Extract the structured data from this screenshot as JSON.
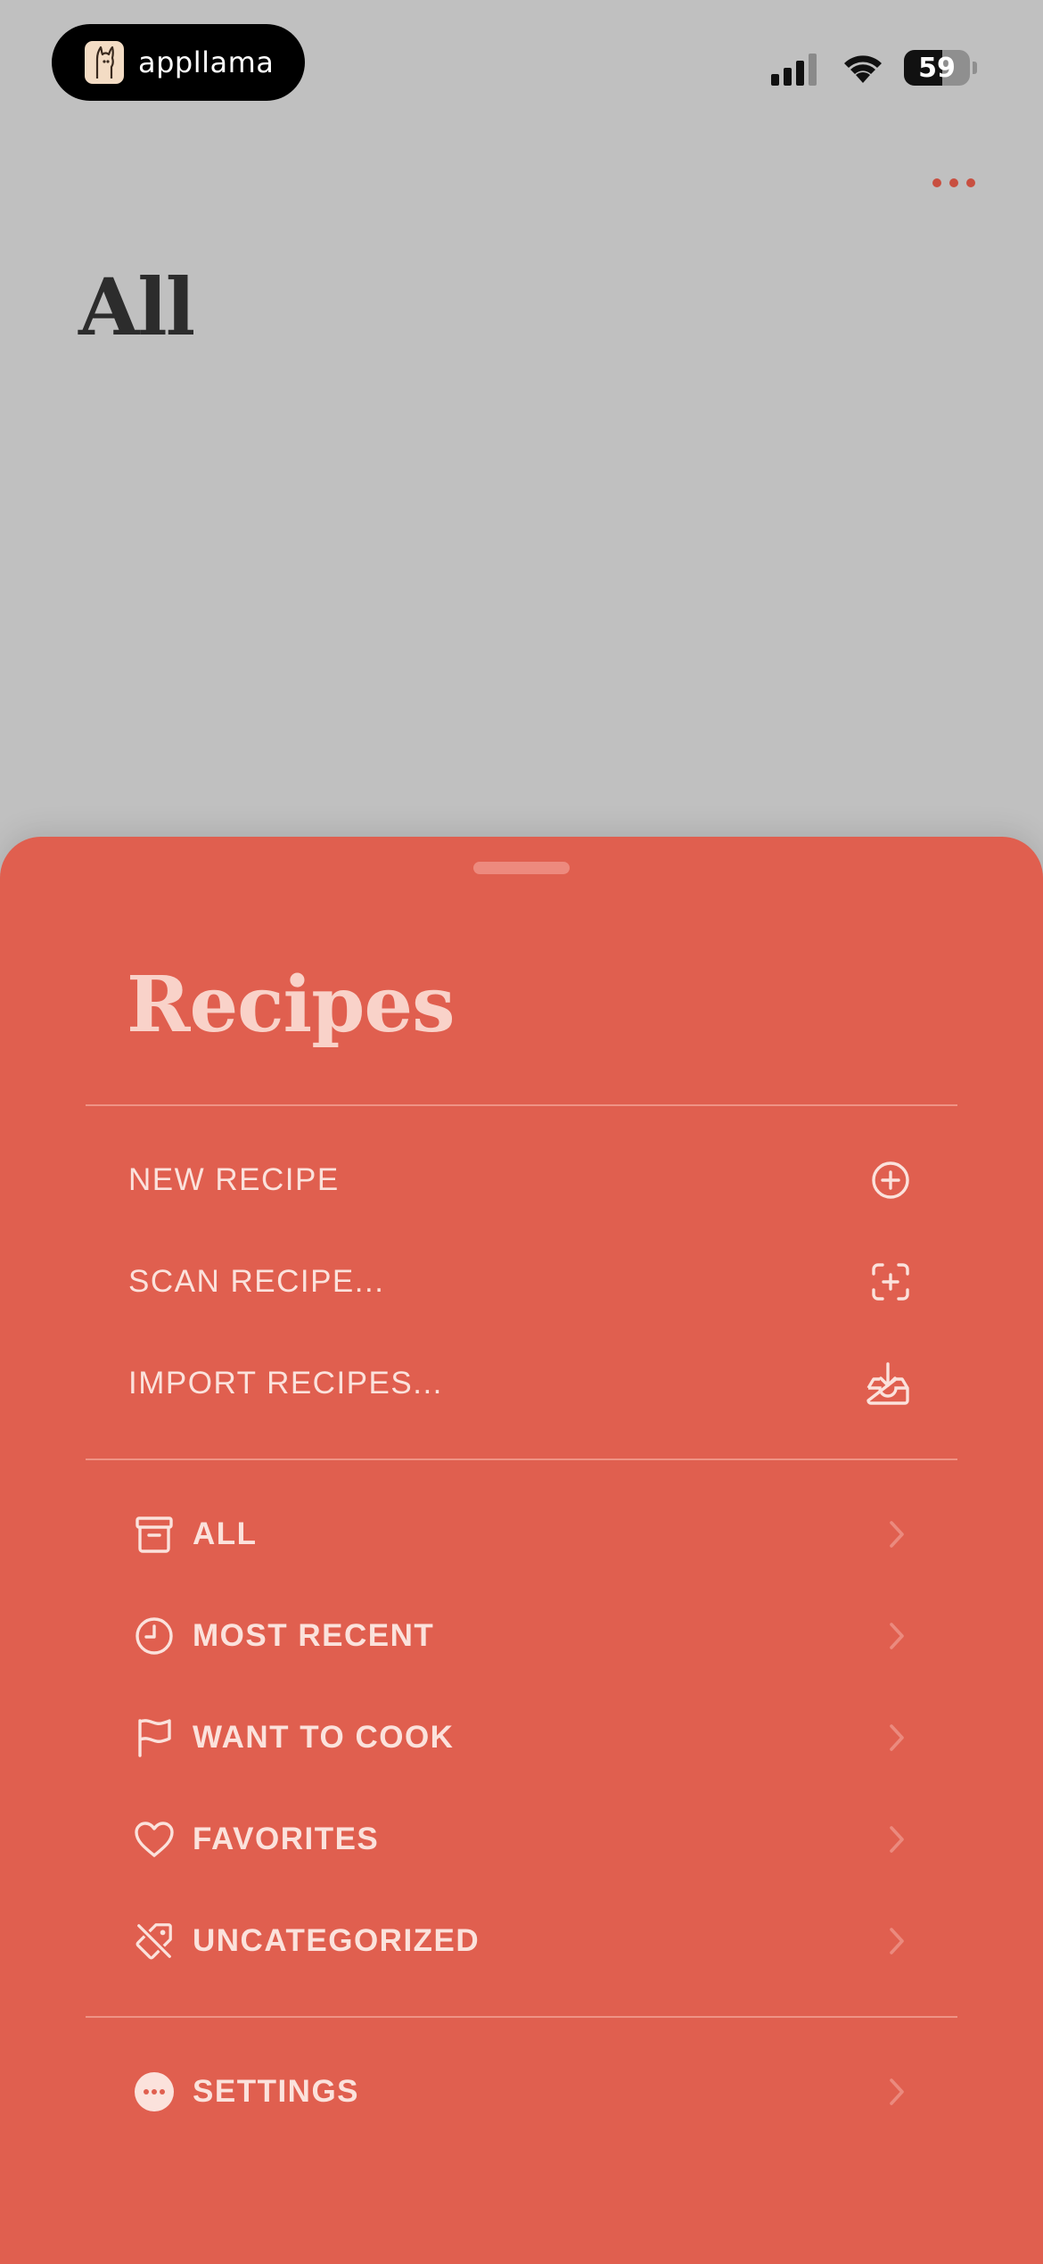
{
  "status_bar": {
    "brand_name": "appllama",
    "battery_percent": "59",
    "battery_level": 0.59,
    "icons": [
      "signal-icon",
      "wifi-icon",
      "battery-icon"
    ]
  },
  "header": {
    "title": "All",
    "more_icon": "more-dots-icon"
  },
  "sheet": {
    "title": "Recipes",
    "actions": [
      {
        "label": "NEW RECIPE",
        "icon": "plus-circle-icon"
      },
      {
        "label": "SCAN RECIPE...",
        "icon": "scan-plus-icon"
      },
      {
        "label": "IMPORT RECIPES...",
        "icon": "tray-download-icon"
      }
    ],
    "collections": [
      {
        "label": "ALL",
        "icon": "archive-box-icon"
      },
      {
        "label": "MOST RECENT",
        "icon": "clock-icon"
      },
      {
        "label": "WANT TO COOK",
        "icon": "flag-icon"
      },
      {
        "label": "FAVORITES",
        "icon": "heart-icon"
      },
      {
        "label": "UNCATEGORIZED",
        "icon": "tag-slash-icon"
      }
    ],
    "settings": {
      "label": "SETTINGS",
      "icon": "ellipsis-circle-icon"
    }
  },
  "colors": {
    "background": "#c0c0c0",
    "sheet": "#e05f4f",
    "sheet_text": "#fbe2dc",
    "accent": "#c84f40"
  }
}
